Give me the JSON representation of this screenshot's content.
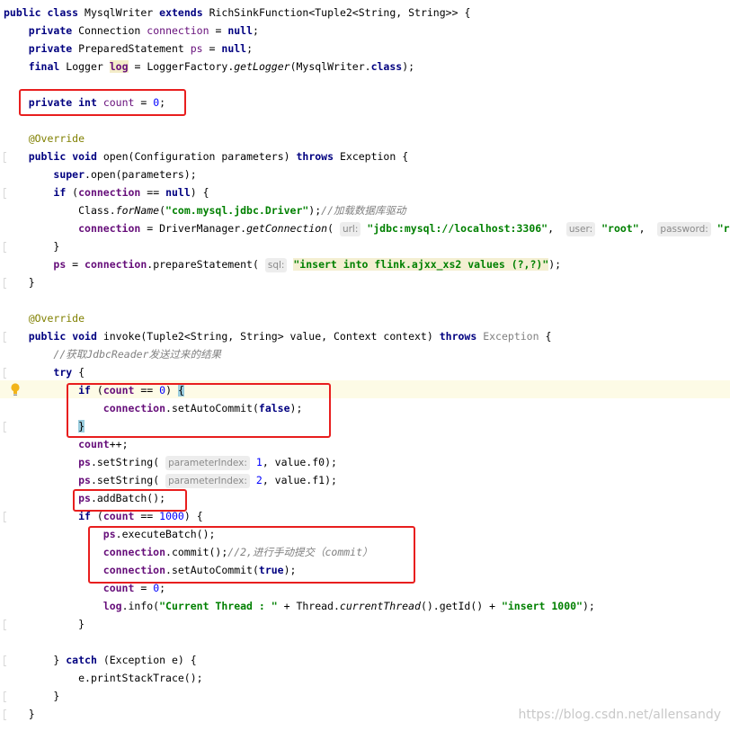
{
  "code": {
    "public": "public",
    "class": "class",
    "extends": "extends",
    "private": "private",
    "final": "final",
    "int": "int",
    "void": "void",
    "throws": "throws",
    "null": "null",
    "false": "false",
    "true": "true",
    "super": "super",
    "if": "if",
    "try": "try",
    "catch": "catch",
    "class_name": "MysqlWriter",
    "base_type": "RichSinkFunction<Tuple2<String, String>>",
    "type_connection": "Connection",
    "type_prepared": "PreparedStatement",
    "type_logger": "Logger",
    "type_configuration": "Configuration",
    "exception": "Exception",
    "field_connection": "connection",
    "field_ps": "ps",
    "field_log": "log",
    "field_count": "count",
    "zero": "0",
    "one": "1",
    "two": "2",
    "thousand": "1000",
    "get_logger_prefix": "LoggerFactory.",
    "get_logger": "getLogger",
    "get_logger_arg": "(MysqlWriter.",
    "override": "@Override",
    "open_sig": "open(Configuration parameters)",
    "super_open": ".open(parameters);",
    "class_for_name_prefix": "Class.",
    "for_name": "forName",
    "driver_string": "\"com.mysql.jdbc.Driver\"",
    "comment_load_driver": "//加载数据库驱动",
    "driver_manager": "DriverManager.",
    "get_connection": "getConnection",
    "hint_url": "url:",
    "jdbc_url": "\"jdbc:mysql://localhost:3306\"",
    "hint_user": "user:",
    "user_value": "\"root\"",
    "hint_password": "password:",
    "password_partial": "\"ro",
    "prepare_statement": ".prepareStatement(",
    "hint_sql": "sql:",
    "sql_string": "\"insert into flink.ajxx_xs2 values (?,?)\"",
    "invoke_sig": "invoke(Tuple2<String, String> value, Context context)",
    "comment_result": "//获取JdbcReader发送过来的结果",
    "set_auto_commit": ".setAutoCommit(",
    "count_increment": "++;",
    "set_string": ".setString(",
    "hint_parameter_index": "parameterIndex:",
    "value_f0": ", value.f0);",
    "value_f1": ", value.f1);",
    "add_batch": ".addBatch();",
    "execute_batch": ".executeBatch();",
    "commit": ".commit();",
    "comment_commit": "//2,进行手动提交（commit）",
    "log_info": ".info(",
    "current_thread_string": "\"Current Thread : \"",
    "thread_prefix": " + Thread.",
    "current_thread": "currentThread",
    "get_id": "().getId() + ",
    "insert_1000_string": "\"insert 1000\"",
    "exception_e": "(Exception e)",
    "print_stack_trace": "e.printStackTrace();"
  },
  "watermark": "https://blog.csdn.net/allensandy"
}
